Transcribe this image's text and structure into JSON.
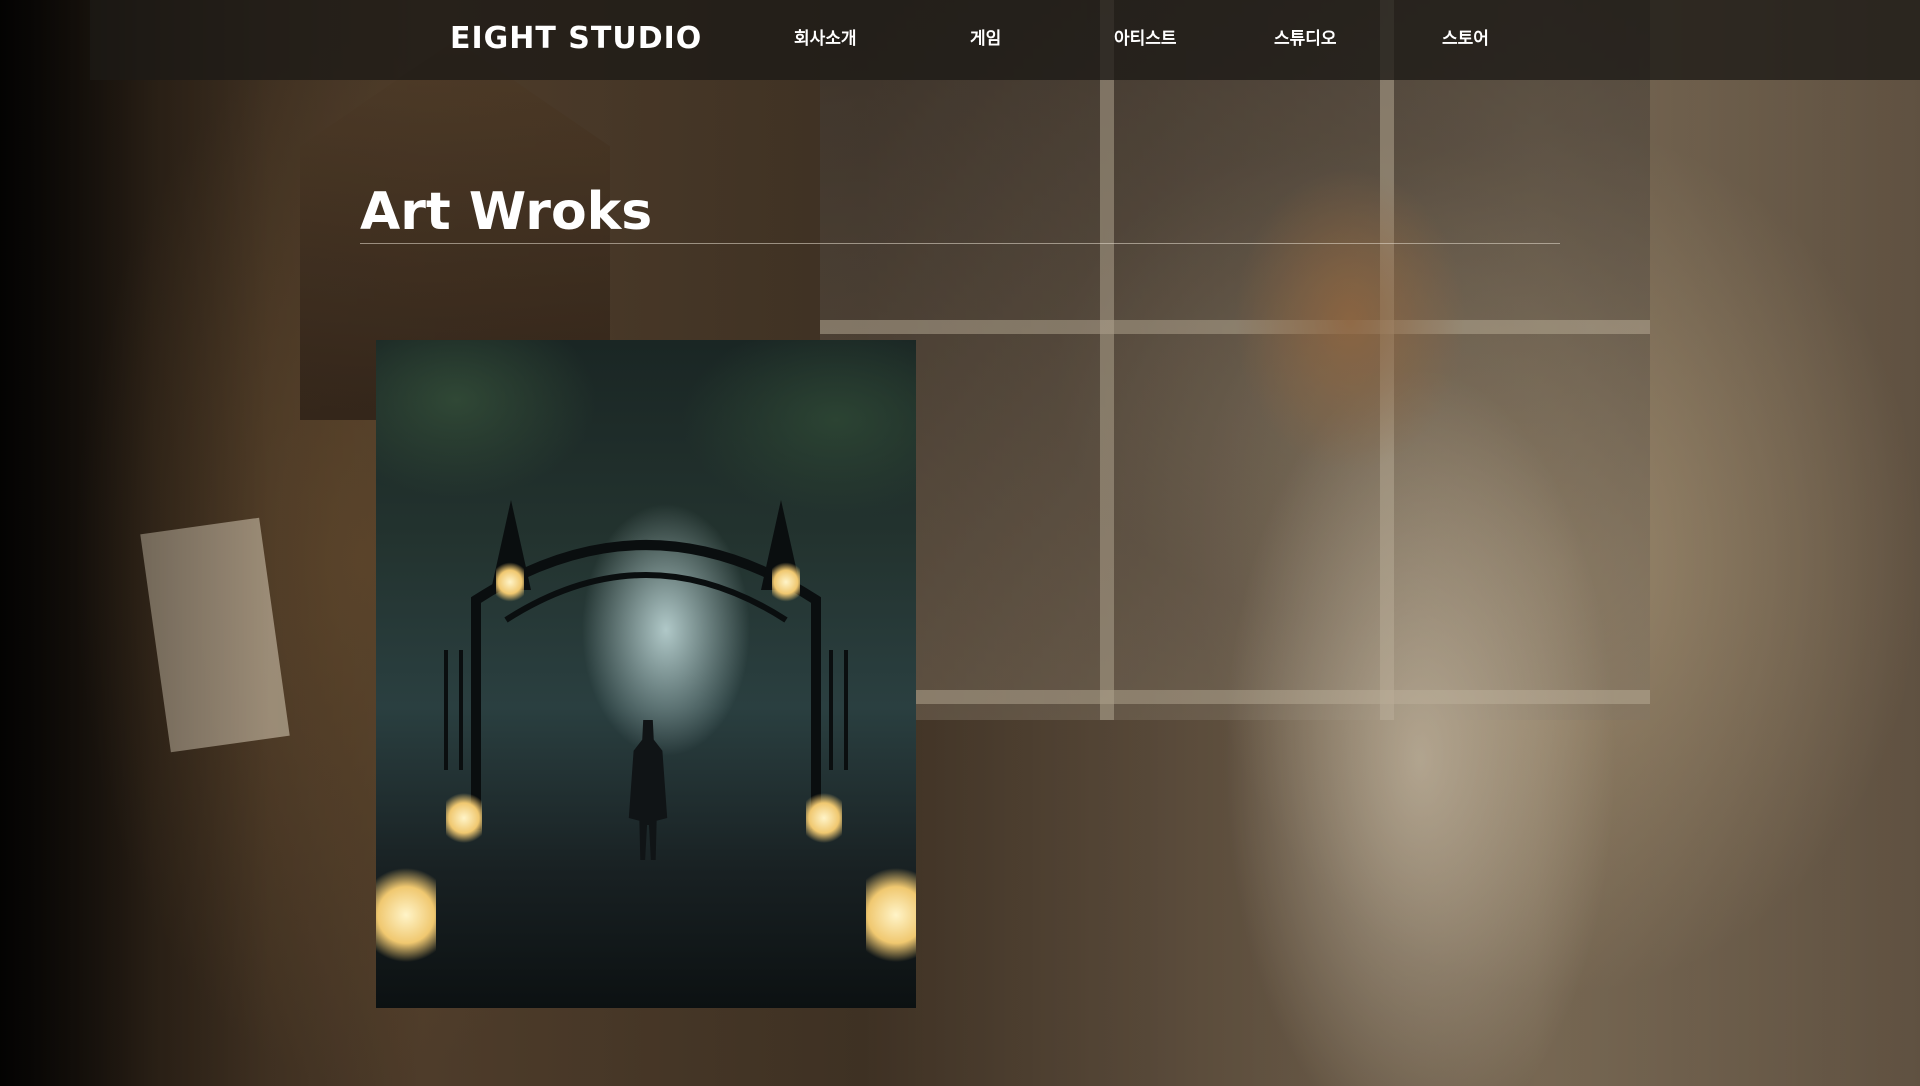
{
  "header": {
    "logo_text": "EIGHT STUDIO",
    "nav": [
      {
        "label": "회사소개"
      },
      {
        "label": "게임"
      },
      {
        "label": "아티스트"
      },
      {
        "label": "스튜디오"
      },
      {
        "label": "스토어"
      }
    ]
  },
  "main": {
    "title": "Art Wroks"
  },
  "colors": {
    "header_bg": "#1c1916",
    "text": "#ffffff",
    "rule": "#e6dccd"
  }
}
